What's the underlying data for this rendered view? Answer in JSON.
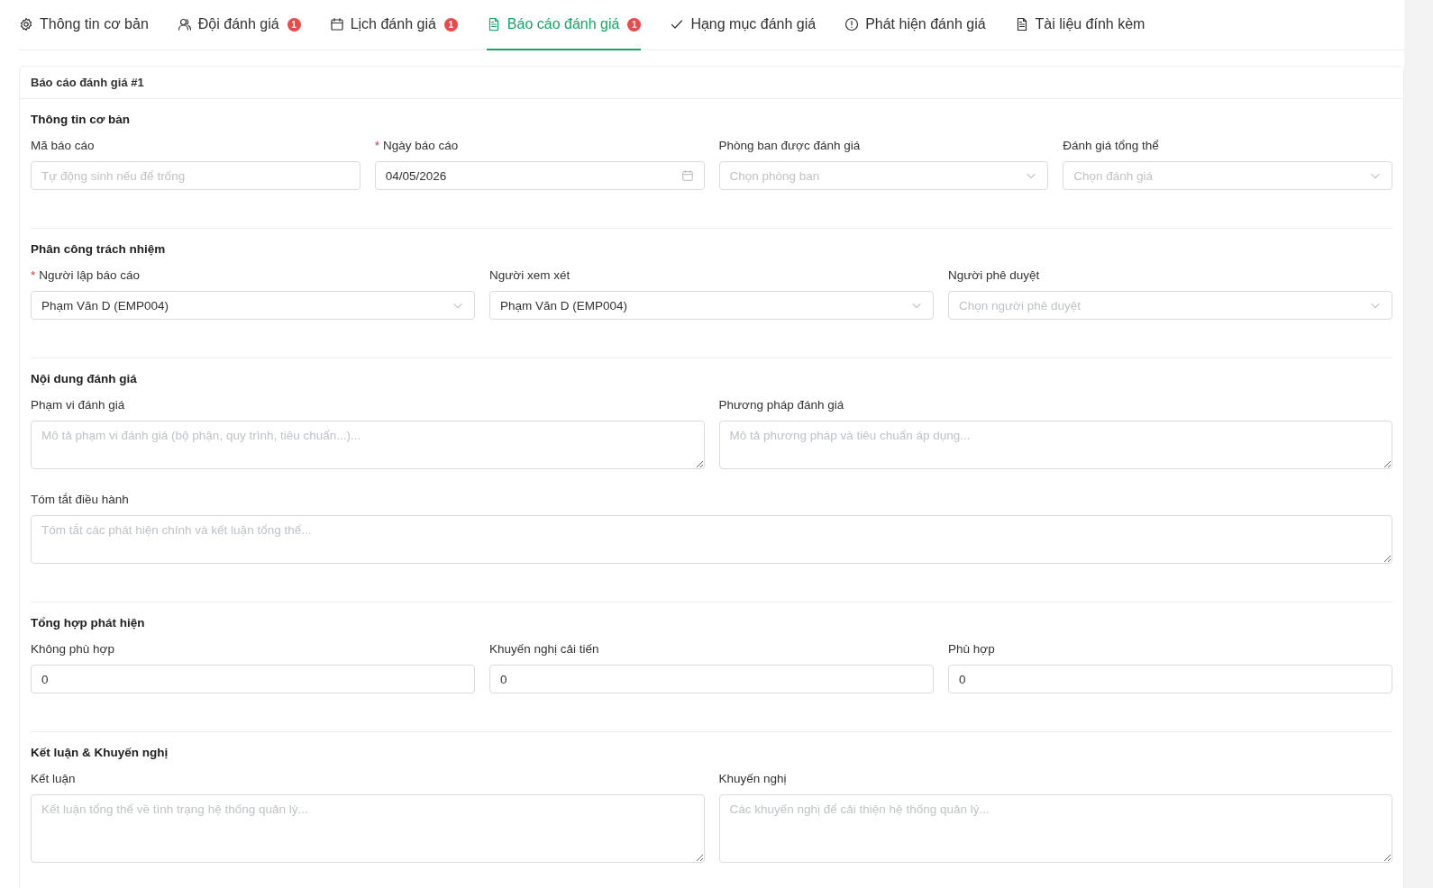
{
  "tabs": [
    {
      "label": "Thông tin cơ bản",
      "selected": false
    },
    {
      "label": "Đội đánh giá",
      "selected": false,
      "badge": "1"
    },
    {
      "label": "Lịch đánh giá",
      "selected": false,
      "badge": "1"
    },
    {
      "label": "Báo cáo đánh giá",
      "selected": true,
      "badge": "1"
    },
    {
      "label": "Hạng mục đánh giá",
      "selected": false
    },
    {
      "label": "Phát hiện đánh giá",
      "selected": false
    },
    {
      "label": "Tài liệu đính kèm",
      "selected": false
    }
  ],
  "card": {
    "title": "Báo cáo đánh giá #1",
    "sections": [
      {
        "title": "Thông tin cơ bản",
        "rows": [
          [
            {
              "label": "Mã báo cáo",
              "kind": "input",
              "placeholder": "Tự động sinh nếu để trống"
            },
            {
              "label": "Ngày báo cáo",
              "kind": "date",
              "required_mark": "*",
              "value": "04/05/2026"
            },
            {
              "label": "Phòng ban được đánh giá",
              "kind": "select",
              "placeholder": "Chọn phòng ban"
            },
            {
              "label": "Đánh giá tổng thể",
              "kind": "select",
              "placeholder": "Chọn đánh giá"
            }
          ]
        ]
      },
      {
        "title": "Phân công trách nhiệm",
        "rows": [
          [
            {
              "label": "Người lập báo cáo",
              "kind": "select",
              "required_mark": "*",
              "value": "Phạm Văn D (EMP004)"
            },
            {
              "label": "Người xem xét",
              "kind": "select",
              "value": "Phạm Văn D (EMP004)"
            },
            {
              "label": "Người phê duyệt",
              "kind": "select",
              "placeholder": "Chọn người phê duyệt"
            }
          ]
        ]
      },
      {
        "title": "Nội dung đánh giá",
        "rows": [
          [
            {
              "label": "Phạm vi đánh giá",
              "kind": "textarea",
              "placeholder": "Mô tả phạm vi đánh giá (bộ phận, quy trình, tiêu chuẩn...)..."
            },
            {
              "label": "Phương pháp đánh giá",
              "kind": "textarea",
              "placeholder": "Mô tả phương pháp và tiêu chuẩn áp dụng..."
            }
          ],
          [
            {
              "label": "Tóm tắt điều hành",
              "kind": "textarea",
              "placeholder": "Tóm tắt các phát hiện chính và kết luận tổng thể..."
            }
          ]
        ]
      },
      {
        "title": "Tổng hợp phát hiện",
        "rows": [
          [
            {
              "label": "Không phù hợp",
              "kind": "input",
              "value": "0"
            },
            {
              "label": "Khuyến nghị cải tiến",
              "kind": "input",
              "value": "0"
            },
            {
              "label": "Phù hợp",
              "kind": "input",
              "value": "0"
            }
          ]
        ]
      },
      {
        "title": "Kết luận & Khuyến nghị",
        "rows": [
          [
            {
              "label": "Kết luận",
              "kind": "textarea",
              "placeholder": "Kết luận tổng thể về tình trạng hệ thống quản lý..."
            },
            {
              "label": "Khuyến nghị",
              "kind": "textarea",
              "placeholder": "Các khuyến nghị để cải thiện hệ thống quản lý..."
            }
          ]
        ]
      }
    ]
  }
}
